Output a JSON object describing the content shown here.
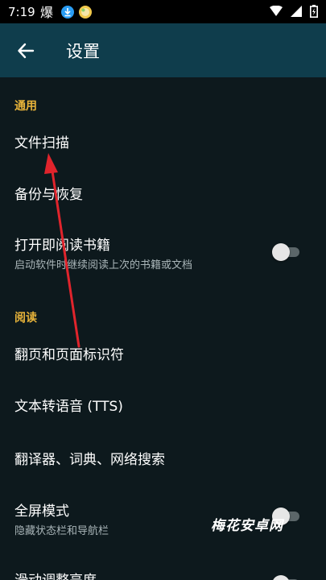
{
  "status_bar": {
    "time": "7:19",
    "icons": [
      "notification-bomb-icon",
      "download-icon",
      "app-ball-icon",
      "wifi-icon",
      "cell-signal-icon",
      "battery-icon"
    ]
  },
  "app_bar": {
    "title": "设置",
    "back_icon": "arrow-left-icon"
  },
  "sections": {
    "general": {
      "header": "通用",
      "items": {
        "file_scan": {
          "title": "文件扫描"
        },
        "backup": {
          "title": "备份与恢复"
        },
        "open_book": {
          "title": "打开即阅读书籍",
          "subtitle": "启动软件时继续阅读上次的书籍或文档",
          "switch_on": false
        }
      }
    },
    "reading": {
      "header": "阅读",
      "items": {
        "page_flip": {
          "title": "翻页和页面标识符"
        },
        "tts": {
          "title": "文本转语音 (TTS)"
        },
        "translator": {
          "title": "翻译器、词典、网络搜索"
        },
        "fullscreen": {
          "title": "全屏模式",
          "subtitle": "隐藏状态栏和导航栏",
          "switch_on": false
        },
        "brightness": {
          "title": "滑动调整亮度"
        }
      }
    }
  },
  "watermark": "梅花安卓网",
  "colors": {
    "background": "#0d191d",
    "app_bar": "#0f3d4c",
    "section_header": "#e8b43a",
    "annotation_arrow": "#e0242c"
  }
}
